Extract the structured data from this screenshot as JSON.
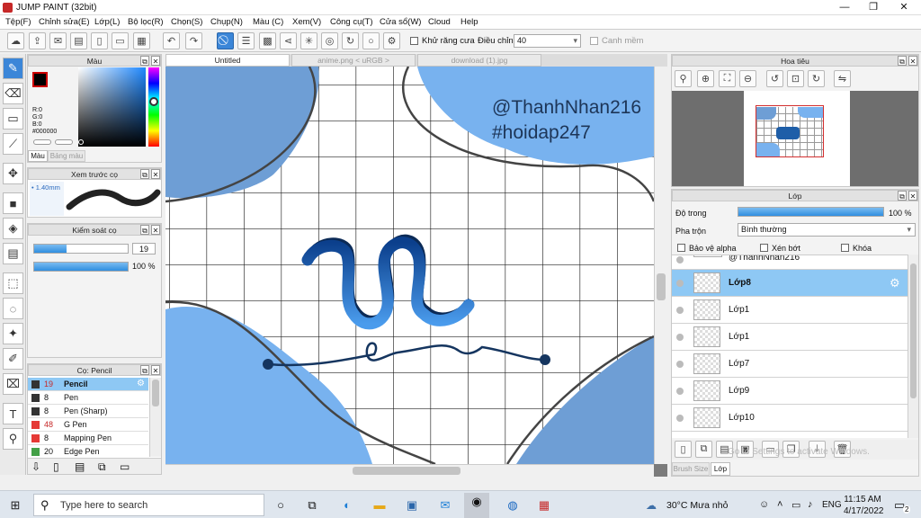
{
  "window": {
    "title": "JUMP PAINT (32bit)"
  },
  "menu": [
    "Tệp(F)",
    "Chỉnh sửa(E)",
    "Lớp(L)",
    "Bộ lọc(R)",
    "Chọn(S)",
    "Chụp(N)",
    "Màu (C)",
    "Xem(V)",
    "Công cụ(T)",
    "Cửa sổ(W)",
    "Cloud",
    "Help"
  ],
  "toolbar": {
    "antialias_label": "Khử răng cưa",
    "adjust_label": "Điều chỉnh",
    "adjust_value": "40",
    "snap_label": "Canh mềm"
  },
  "color_panel": {
    "title": "Màu",
    "r": "R:0",
    "g": "G:0",
    "b": "B:0",
    "hex": "#000000",
    "tab_color": "Màu",
    "tab_palette": "Bảng màu",
    "fg_color": "#000000",
    "bg_color": "#ffffff"
  },
  "brush_preview": {
    "title": "Xem trước cọ",
    "size": "1.40mm"
  },
  "brush_control": {
    "title": "Kiểm soát cọ",
    "size": "19",
    "opacity": "100 %",
    "size_fraction": 0.35,
    "opacity_fraction": 1.0
  },
  "brush_list": {
    "title": "Cọ: Pencil",
    "items": [
      {
        "size": "19",
        "name": "Pencil",
        "color": "#333333"
      },
      {
        "size": "8",
        "name": "Pen",
        "color": "#333333"
      },
      {
        "size": "8",
        "name": "Pen (Sharp)",
        "color": "#333333"
      },
      {
        "size": "48",
        "name": "G Pen",
        "color": "#e53935"
      },
      {
        "size": "8",
        "name": "Mapping Pen",
        "color": "#e53935"
      },
      {
        "size": "20",
        "name": "Edge Pen",
        "color": "#43a047"
      }
    ]
  },
  "tabs": [
    "Untitled",
    "anime.png < uRGB >",
    "download (1).jpg"
  ],
  "canvas": {
    "watermark_line1": "@ThanhNhan216",
    "watermark_line2": "#hoidap247"
  },
  "navigator": {
    "title": "Hoa tiêu"
  },
  "layers": {
    "title": "Lớp",
    "opacity_label": "Độ trong",
    "opacity_value": "100 %",
    "opacity_fraction": 1.0,
    "blend_label": "Pha trộn",
    "blend_value": "Bình thường",
    "protect_alpha": "Bảo vệ alpha",
    "clipping": "Xén bớt",
    "lock": "Khóa",
    "items": [
      {
        "name": "@ThanhNhan216"
      },
      {
        "name": "Lớp8"
      },
      {
        "name": "Lớp1"
      },
      {
        "name": "Lớp1"
      },
      {
        "name": "Lớp7"
      },
      {
        "name": "Lớp9"
      },
      {
        "name": "Lớp10"
      }
    ],
    "bottom_tab_brushsize": "Brush Size",
    "bottom_tab_layer": "Lớp",
    "activate_hint": "Go to Settings to activate Windows."
  },
  "taskbar": {
    "search_placeholder": "Type here to search",
    "weather": "30°C Mưa nhỏ",
    "lang": "ENG",
    "time": "11:15 AM",
    "date": "4/17/2022",
    "notif_count": "2"
  }
}
